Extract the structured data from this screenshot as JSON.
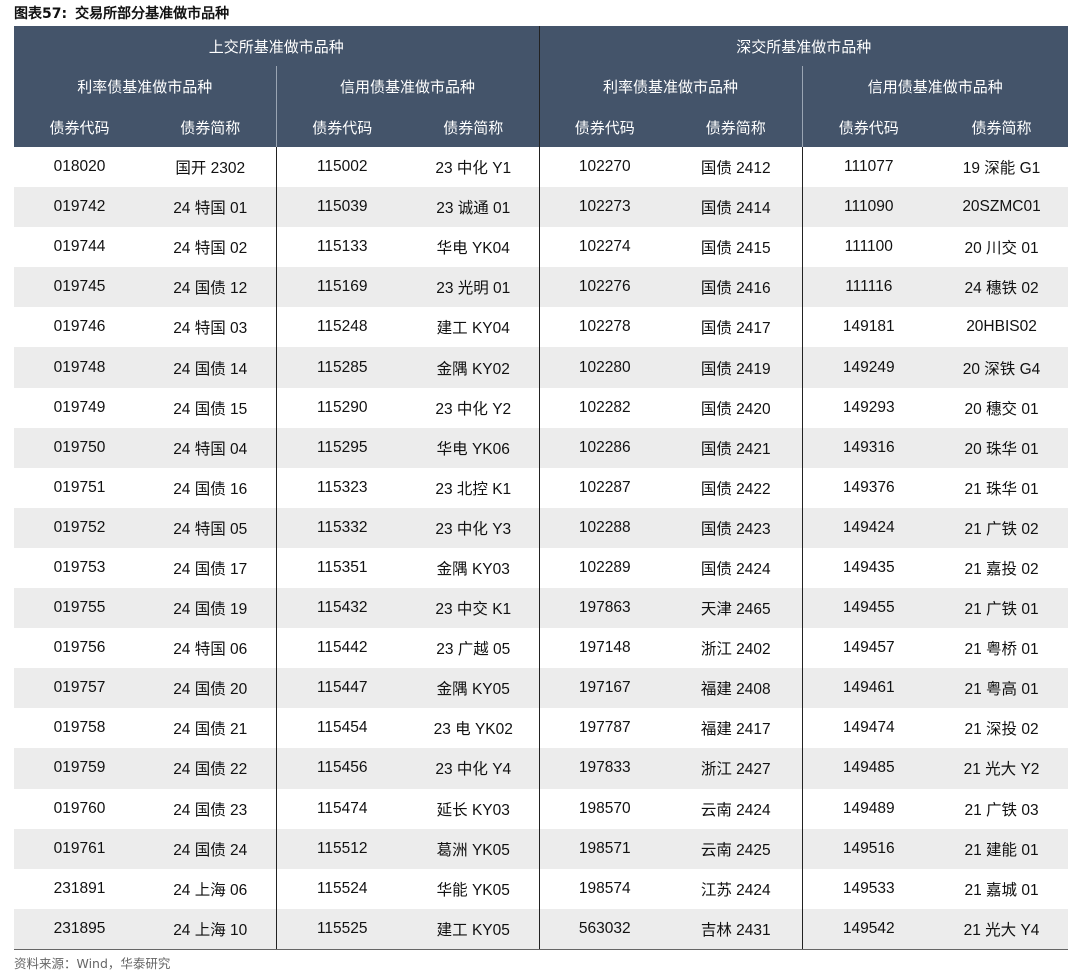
{
  "figure": {
    "label": "图表57:",
    "title": "交易所部分基准做市品种"
  },
  "header": {
    "exchanges": [
      "上交所基准做市品种",
      "深交所基准做市品种"
    ],
    "groups": [
      "利率债基准做市品种",
      "信用债基准做市品种",
      "利率债基准做市品种",
      "信用债基准做市品种"
    ],
    "columns": [
      "债券代码",
      "债券简称",
      "债券代码",
      "债券简称",
      "债券代码",
      "债券简称",
      "债券代码",
      "债券简称"
    ]
  },
  "rows": [
    [
      "018020",
      "国开 2302",
      "115002",
      "23 中化 Y1",
      "102270",
      "国债 2412",
      "111077",
      "19 深能 G1"
    ],
    [
      "019742",
      "24 特国 01",
      "115039",
      "23 诚通 01",
      "102273",
      "国债 2414",
      "111090",
      "20SZMC01"
    ],
    [
      "019744",
      "24 特国 02",
      "115133",
      "华电 YK04",
      "102274",
      "国债 2415",
      "111100",
      "20 川交 01"
    ],
    [
      "019745",
      "24 国债 12",
      "115169",
      "23 光明 01",
      "102276",
      "国债 2416",
      "111116",
      "24 穗铁 02"
    ],
    [
      "019746",
      "24 特国 03",
      "115248",
      "建工 KY04",
      "102278",
      "国债 2417",
      "149181",
      "20HBIS02"
    ],
    [
      "019748",
      "24 国债 14",
      "115285",
      "金隅 KY02",
      "102280",
      "国债 2419",
      "149249",
      "20 深铁 G4"
    ],
    [
      "019749",
      "24 国债 15",
      "115290",
      "23 中化 Y2",
      "102282",
      "国债 2420",
      "149293",
      "20 穗交 01"
    ],
    [
      "019750",
      "24 特国 04",
      "115295",
      "华电 YK06",
      "102286",
      "国债 2421",
      "149316",
      "20 珠华 01"
    ],
    [
      "019751",
      "24 国债 16",
      "115323",
      "23 北控 K1",
      "102287",
      "国债 2422",
      "149376",
      "21 珠华 01"
    ],
    [
      "019752",
      "24 特国 05",
      "115332",
      "23 中化 Y3",
      "102288",
      "国债 2423",
      "149424",
      "21 广铁 02"
    ],
    [
      "019753",
      "24 国债 17",
      "115351",
      "金隅 KY03",
      "102289",
      "国债 2424",
      "149435",
      "21 嘉投 02"
    ],
    [
      "019755",
      "24 国债 19",
      "115432",
      "23 中交 K1",
      "197863",
      "天津 2465",
      "149455",
      "21 广铁 01"
    ],
    [
      "019756",
      "24 特国 06",
      "115442",
      "23 广越 05",
      "197148",
      "浙江 2402",
      "149457",
      "21 粤桥 01"
    ],
    [
      "019757",
      "24 国债 20",
      "115447",
      "金隅 KY05",
      "197167",
      "福建 2408",
      "149461",
      "21 粤高 01"
    ],
    [
      "019758",
      "24 国债 21",
      "115454",
      "23 电 YK02",
      "197787",
      "福建 2417",
      "149474",
      "21 深投 02"
    ],
    [
      "019759",
      "24 国债 22",
      "115456",
      "23 中化 Y4",
      "197833",
      "浙江 2427",
      "149485",
      "21 光大 Y2"
    ],
    [
      "019760",
      "24 国债 23",
      "115474",
      "延长 KY03",
      "198570",
      "云南 2424",
      "149489",
      "21 广铁 03"
    ],
    [
      "019761",
      "24 国债 24",
      "115512",
      "葛洲 YK05",
      "198571",
      "云南 2425",
      "149516",
      "21 建能 01"
    ],
    [
      "231891",
      "24 上海 06",
      "115524",
      "华能 YK05",
      "198574",
      "江苏 2424",
      "149533",
      "21 嘉城 01"
    ],
    [
      "231895",
      "24 上海 10",
      "115525",
      "建工 KY05",
      "563032",
      "吉林 2431",
      "149542",
      "21 光大 Y4"
    ]
  ],
  "source": "资料来源：Wind，华泰研究"
}
